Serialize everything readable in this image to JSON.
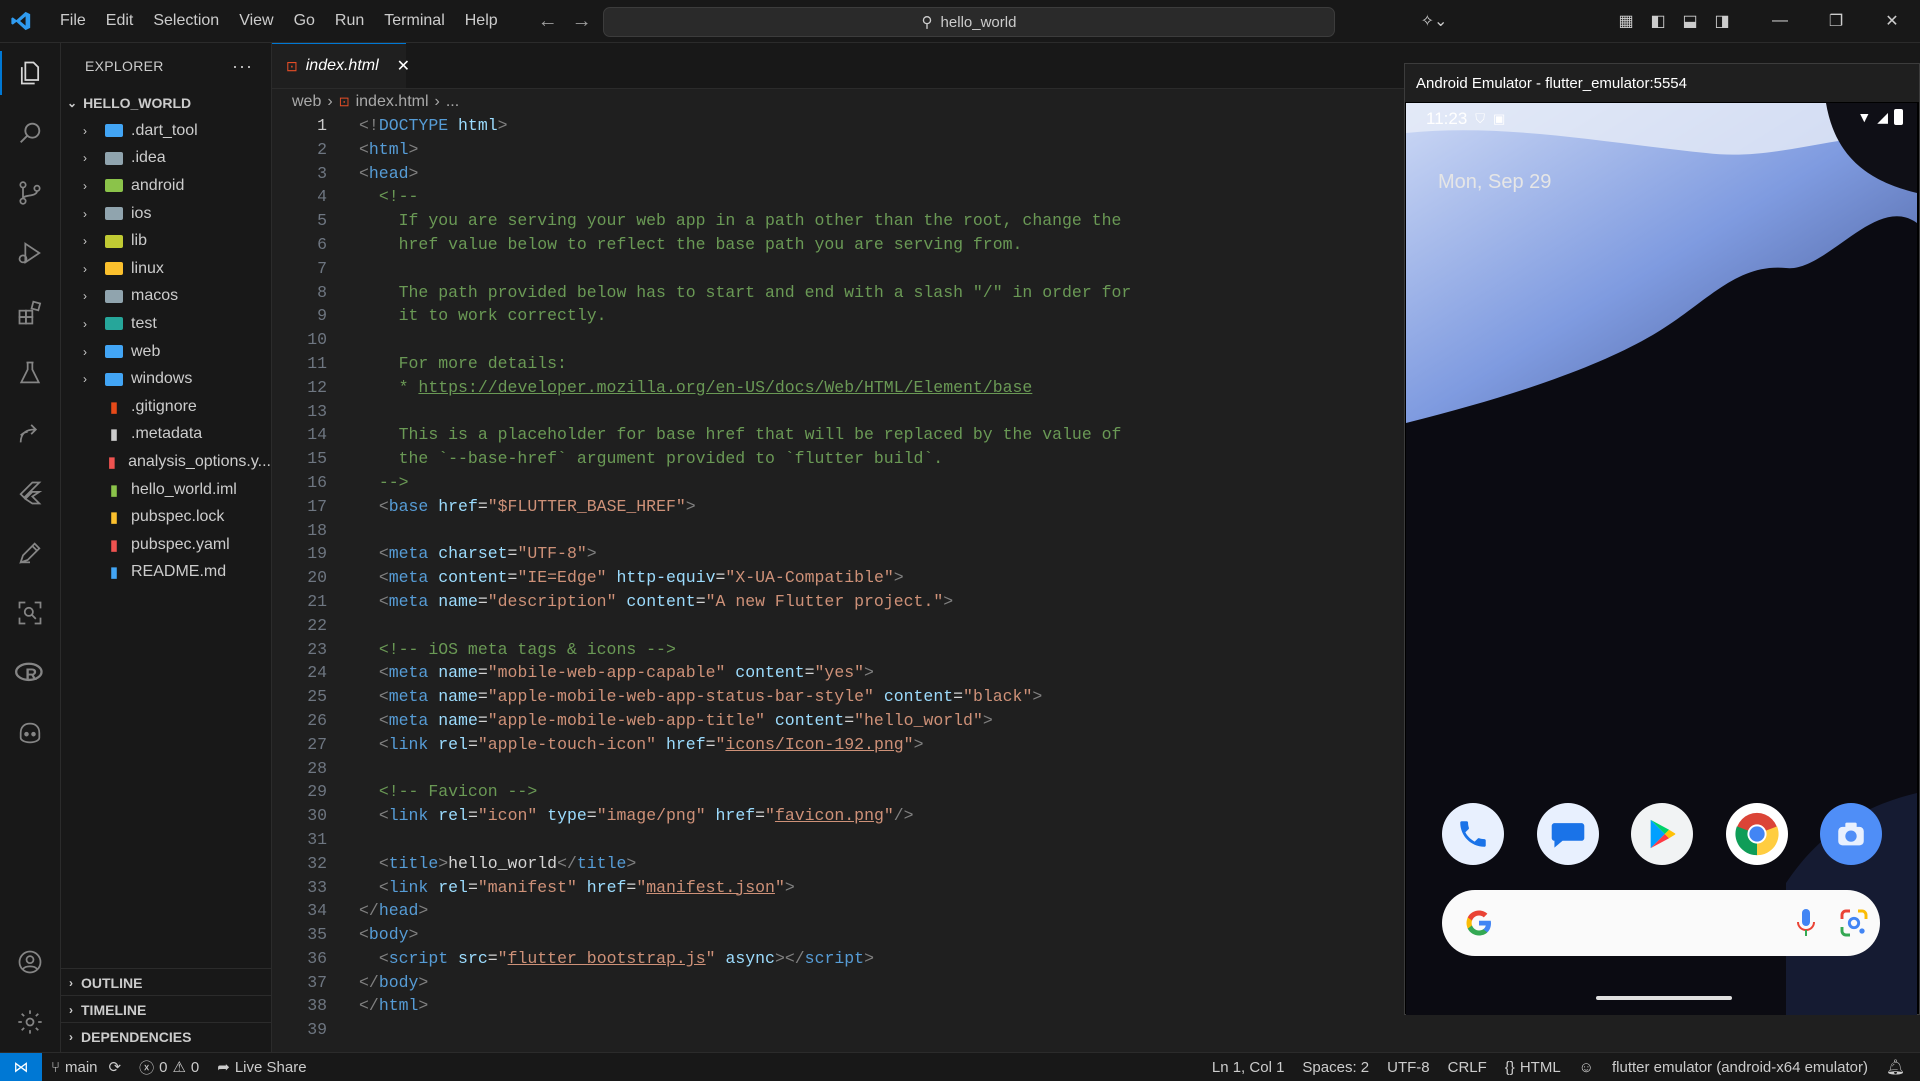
{
  "menu": [
    "File",
    "Edit",
    "Selection",
    "View",
    "Go",
    "Run",
    "Terminal",
    "Help"
  ],
  "search": {
    "text": "hello_world"
  },
  "sidebar": {
    "title": "EXPLORER",
    "root": "HELLO_WORLD",
    "items": [
      {
        "name": ".dart_tool",
        "type": "folder",
        "color": "#42a5f5"
      },
      {
        "name": ".idea",
        "type": "folder",
        "color": "#90a4ae"
      },
      {
        "name": "android",
        "type": "folder",
        "color": "#8bc34a"
      },
      {
        "name": "ios",
        "type": "folder",
        "color": "#90a4ae"
      },
      {
        "name": "lib",
        "type": "folder",
        "color": "#c0ca33"
      },
      {
        "name": "linux",
        "type": "folder",
        "color": "#fbc02d"
      },
      {
        "name": "macos",
        "type": "folder",
        "color": "#90a4ae"
      },
      {
        "name": "test",
        "type": "folder",
        "color": "#26a69a"
      },
      {
        "name": "web",
        "type": "folder",
        "color": "#42a5f5"
      },
      {
        "name": "windows",
        "type": "folder",
        "color": "#42a5f5"
      },
      {
        "name": ".gitignore",
        "type": "file",
        "color": "#e64a19"
      },
      {
        "name": ".metadata",
        "type": "file",
        "color": "#cccccc"
      },
      {
        "name": "analysis_options.y...",
        "type": "file",
        "color": "#ef5350"
      },
      {
        "name": "hello_world.iml",
        "type": "file",
        "color": "#8bc34a"
      },
      {
        "name": "pubspec.lock",
        "type": "file",
        "color": "#fbc02d"
      },
      {
        "name": "pubspec.yaml",
        "type": "file",
        "color": "#ef5350"
      },
      {
        "name": "README.md",
        "type": "file",
        "color": "#42a5f5"
      }
    ],
    "sections": [
      "OUTLINE",
      "TIMELINE",
      "DEPENDENCIES"
    ]
  },
  "editor": {
    "tab": "index.html",
    "breadcrumb": [
      "web",
      "index.html",
      "..."
    ],
    "lines": [
      [
        [
          "br",
          "<!"
        ],
        [
          "tag",
          "DOCTYPE"
        ],
        [
          "txt",
          " "
        ],
        [
          "attr",
          "html"
        ],
        [
          "br",
          ">"
        ]
      ],
      [
        [
          "br",
          "<"
        ],
        [
          "tag",
          "html"
        ],
        [
          "br",
          ">"
        ]
      ],
      [
        [
          "br",
          "<"
        ],
        [
          "tag",
          "head"
        ],
        [
          "br",
          ">"
        ]
      ],
      [
        [
          "txt",
          "  "
        ],
        [
          "com",
          "<!--"
        ]
      ],
      [
        [
          "txt",
          "    "
        ],
        [
          "com",
          "If you are serving your web app in a path other than the root, change the"
        ]
      ],
      [
        [
          "txt",
          "    "
        ],
        [
          "com",
          "href value below to reflect the base path you are serving from."
        ]
      ],
      [],
      [
        [
          "txt",
          "    "
        ],
        [
          "com",
          "The path provided below has to start and end with a slash \"/\" in order for"
        ]
      ],
      [
        [
          "txt",
          "    "
        ],
        [
          "com",
          "it to work correctly."
        ]
      ],
      [],
      [
        [
          "txt",
          "    "
        ],
        [
          "com",
          "For more details:"
        ]
      ],
      [
        [
          "txt",
          "    "
        ],
        [
          "com",
          "* "
        ],
        [
          "comlink",
          "https://developer.mozilla.org/en-US/docs/Web/HTML/Element/base"
        ]
      ],
      [],
      [
        [
          "txt",
          "    "
        ],
        [
          "com",
          "This is a placeholder for base href that will be replaced by the value of"
        ]
      ],
      [
        [
          "txt",
          "    "
        ],
        [
          "com",
          "the `--base-href` argument provided to `flutter build`."
        ]
      ],
      [
        [
          "txt",
          "  "
        ],
        [
          "com",
          "-->"
        ]
      ],
      [
        [
          "txt",
          "  "
        ],
        [
          "br",
          "<"
        ],
        [
          "tag",
          "base"
        ],
        [
          "txt",
          " "
        ],
        [
          "attr",
          "href"
        ],
        [
          "txt",
          "="
        ],
        [
          "str",
          "\"$FLUTTER_BASE_HREF\""
        ],
        [
          "br",
          ">"
        ]
      ],
      [],
      [
        [
          "txt",
          "  "
        ],
        [
          "br",
          "<"
        ],
        [
          "tag",
          "meta"
        ],
        [
          "txt",
          " "
        ],
        [
          "attr",
          "charset"
        ],
        [
          "txt",
          "="
        ],
        [
          "str",
          "\"UTF-8\""
        ],
        [
          "br",
          ">"
        ]
      ],
      [
        [
          "txt",
          "  "
        ],
        [
          "br",
          "<"
        ],
        [
          "tag",
          "meta"
        ],
        [
          "txt",
          " "
        ],
        [
          "attr",
          "content"
        ],
        [
          "txt",
          "="
        ],
        [
          "str",
          "\"IE=Edge\""
        ],
        [
          "txt",
          " "
        ],
        [
          "attr",
          "http-equiv"
        ],
        [
          "txt",
          "="
        ],
        [
          "str",
          "\"X-UA-Compatible\""
        ],
        [
          "br",
          ">"
        ]
      ],
      [
        [
          "txt",
          "  "
        ],
        [
          "br",
          "<"
        ],
        [
          "tag",
          "meta"
        ],
        [
          "txt",
          " "
        ],
        [
          "attr",
          "name"
        ],
        [
          "txt",
          "="
        ],
        [
          "str",
          "\"description\""
        ],
        [
          "txt",
          " "
        ],
        [
          "attr",
          "content"
        ],
        [
          "txt",
          "="
        ],
        [
          "str",
          "\"A new Flutter project.\""
        ],
        [
          "br",
          ">"
        ]
      ],
      [],
      [
        [
          "txt",
          "  "
        ],
        [
          "com",
          "<!-- iOS meta tags & icons -->"
        ]
      ],
      [
        [
          "txt",
          "  "
        ],
        [
          "br",
          "<"
        ],
        [
          "tag",
          "meta"
        ],
        [
          "txt",
          " "
        ],
        [
          "attr",
          "name"
        ],
        [
          "txt",
          "="
        ],
        [
          "str",
          "\"mobile-web-app-capable\""
        ],
        [
          "txt",
          " "
        ],
        [
          "attr",
          "content"
        ],
        [
          "txt",
          "="
        ],
        [
          "str",
          "\"yes\""
        ],
        [
          "br",
          ">"
        ]
      ],
      [
        [
          "txt",
          "  "
        ],
        [
          "br",
          "<"
        ],
        [
          "tag",
          "meta"
        ],
        [
          "txt",
          " "
        ],
        [
          "attr",
          "name"
        ],
        [
          "txt",
          "="
        ],
        [
          "str",
          "\"apple-mobile-web-app-status-bar-style\""
        ],
        [
          "txt",
          " "
        ],
        [
          "attr",
          "content"
        ],
        [
          "txt",
          "="
        ],
        [
          "str",
          "\"black\""
        ],
        [
          "br",
          ">"
        ]
      ],
      [
        [
          "txt",
          "  "
        ],
        [
          "br",
          "<"
        ],
        [
          "tag",
          "meta"
        ],
        [
          "txt",
          " "
        ],
        [
          "attr",
          "name"
        ],
        [
          "txt",
          "="
        ],
        [
          "str",
          "\"apple-mobile-web-app-title\""
        ],
        [
          "txt",
          " "
        ],
        [
          "attr",
          "content"
        ],
        [
          "txt",
          "="
        ],
        [
          "str",
          "\"hello_world\""
        ],
        [
          "br",
          ">"
        ]
      ],
      [
        [
          "txt",
          "  "
        ],
        [
          "br",
          "<"
        ],
        [
          "tag",
          "link"
        ],
        [
          "txt",
          " "
        ],
        [
          "attr",
          "rel"
        ],
        [
          "txt",
          "="
        ],
        [
          "str",
          "\"apple-touch-icon\""
        ],
        [
          "txt",
          " "
        ],
        [
          "attr",
          "href"
        ],
        [
          "txt",
          "="
        ],
        [
          "str",
          "\""
        ],
        [
          "strlink",
          "icons/Icon-192.png"
        ],
        [
          "str",
          "\""
        ],
        [
          "br",
          ">"
        ]
      ],
      [],
      [
        [
          "txt",
          "  "
        ],
        [
          "com",
          "<!-- Favicon -->"
        ]
      ],
      [
        [
          "txt",
          "  "
        ],
        [
          "br",
          "<"
        ],
        [
          "tag",
          "link"
        ],
        [
          "txt",
          " "
        ],
        [
          "attr",
          "rel"
        ],
        [
          "txt",
          "="
        ],
        [
          "str",
          "\"icon\""
        ],
        [
          "txt",
          " "
        ],
        [
          "attr",
          "type"
        ],
        [
          "txt",
          "="
        ],
        [
          "str",
          "\"image/png\""
        ],
        [
          "txt",
          " "
        ],
        [
          "attr",
          "href"
        ],
        [
          "txt",
          "="
        ],
        [
          "str",
          "\""
        ],
        [
          "strlink",
          "favicon.png"
        ],
        [
          "str",
          "\""
        ],
        [
          "br",
          "/>"
        ]
      ],
      [],
      [
        [
          "txt",
          "  "
        ],
        [
          "br",
          "<"
        ],
        [
          "tag",
          "title"
        ],
        [
          "br",
          ">"
        ],
        [
          "txt",
          "hello_world"
        ],
        [
          "br",
          "</"
        ],
        [
          "tag",
          "title"
        ],
        [
          "br",
          ">"
        ]
      ],
      [
        [
          "txt",
          "  "
        ],
        [
          "br",
          "<"
        ],
        [
          "tag",
          "link"
        ],
        [
          "txt",
          " "
        ],
        [
          "attr",
          "rel"
        ],
        [
          "txt",
          "="
        ],
        [
          "str",
          "\"manifest\""
        ],
        [
          "txt",
          " "
        ],
        [
          "attr",
          "href"
        ],
        [
          "txt",
          "="
        ],
        [
          "str",
          "\""
        ],
        [
          "strlink",
          "manifest.json"
        ],
        [
          "str",
          "\""
        ],
        [
          "br",
          ">"
        ]
      ],
      [
        [
          "br",
          "</"
        ],
        [
          "tag",
          "head"
        ],
        [
          "br",
          ">"
        ]
      ],
      [
        [
          "br",
          "<"
        ],
        [
          "tag",
          "body"
        ],
        [
          "br",
          ">"
        ]
      ],
      [
        [
          "txt",
          "  "
        ],
        [
          "br",
          "<"
        ],
        [
          "tag",
          "script"
        ],
        [
          "txt",
          " "
        ],
        [
          "attr",
          "src"
        ],
        [
          "txt",
          "="
        ],
        [
          "str",
          "\""
        ],
        [
          "strlink",
          "flutter_bootstrap.js"
        ],
        [
          "str",
          "\""
        ],
        [
          "txt",
          " "
        ],
        [
          "attr",
          "async"
        ],
        [
          "br",
          "></"
        ],
        [
          "tag",
          "script"
        ],
        [
          "br",
          ">"
        ]
      ],
      [
        [
          "br",
          "</"
        ],
        [
          "tag",
          "body"
        ],
        [
          "br",
          ">"
        ]
      ],
      [
        [
          "br",
          "</"
        ],
        [
          "tag",
          "html"
        ],
        [
          "br",
          ">"
        ]
      ],
      []
    ]
  },
  "emulator": {
    "title": "Android Emulator - flutter_emulator:5554",
    "time": "11:23",
    "date": "Mon, Sep 29"
  },
  "statusbar": {
    "branch": "main",
    "errors": "0",
    "warnings": "0",
    "liveshare": "Live Share",
    "position": "Ln 1, Col 1",
    "spaces": "Spaces: 2",
    "encoding": "UTF-8",
    "eol": "CRLF",
    "language": "HTML",
    "device": "flutter emulator (android-x64 emulator)"
  },
  "colors": {
    "accent": "#0078d4"
  }
}
